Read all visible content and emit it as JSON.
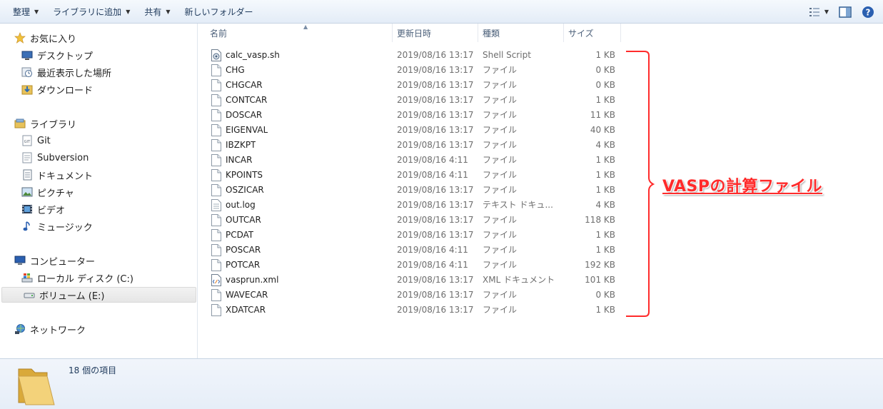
{
  "toolbar": {
    "organize": "整理",
    "add_to_library": "ライブラリに追加",
    "share": "共有",
    "new_folder": "新しいフォルダー"
  },
  "nav": {
    "favorites": "お気に入り",
    "desktop": "デスクトップ",
    "recent": "最近表示した場所",
    "downloads": "ダウンロード",
    "libraries": "ライブラリ",
    "git": "Git",
    "subversion": "Subversion",
    "documents": "ドキュメント",
    "pictures": "ピクチャ",
    "videos": "ビデオ",
    "music": "ミュージック",
    "computer": "コンピューター",
    "local_disk": "ローカル ディスク (C:)",
    "volume": "ボリューム (E:)",
    "network": "ネットワーク"
  },
  "columns": {
    "name": "名前",
    "date": "更新日時",
    "type": "種類",
    "size": "サイズ"
  },
  "files": [
    {
      "name": "calc_vasp.sh",
      "date": "2019/08/16 13:17",
      "type": "Shell Script",
      "size": "1 KB",
      "icon": "script-icon"
    },
    {
      "name": "CHG",
      "date": "2019/08/16 13:17",
      "type": "ファイル",
      "size": "0 KB",
      "icon": "file-icon"
    },
    {
      "name": "CHGCAR",
      "date": "2019/08/16 13:17",
      "type": "ファイル",
      "size": "0 KB",
      "icon": "file-icon"
    },
    {
      "name": "CONTCAR",
      "date": "2019/08/16 13:17",
      "type": "ファイル",
      "size": "1 KB",
      "icon": "file-icon"
    },
    {
      "name": "DOSCAR",
      "date": "2019/08/16 13:17",
      "type": "ファイル",
      "size": "11 KB",
      "icon": "file-icon"
    },
    {
      "name": "EIGENVAL",
      "date": "2019/08/16 13:17",
      "type": "ファイル",
      "size": "40 KB",
      "icon": "file-icon"
    },
    {
      "name": "IBZKPT",
      "date": "2019/08/16 13:17",
      "type": "ファイル",
      "size": "4 KB",
      "icon": "file-icon"
    },
    {
      "name": "INCAR",
      "date": "2019/08/16 4:11",
      "type": "ファイル",
      "size": "1 KB",
      "icon": "file-icon"
    },
    {
      "name": "KPOINTS",
      "date": "2019/08/16 4:11",
      "type": "ファイル",
      "size": "1 KB",
      "icon": "file-icon"
    },
    {
      "name": "OSZICAR",
      "date": "2019/08/16 13:17",
      "type": "ファイル",
      "size": "1 KB",
      "icon": "file-icon"
    },
    {
      "name": "out.log",
      "date": "2019/08/16 13:17",
      "type": "テキスト ドキュ...",
      "size": "4 KB",
      "icon": "text-file-icon"
    },
    {
      "name": "OUTCAR",
      "date": "2019/08/16 13:17",
      "type": "ファイル",
      "size": "118 KB",
      "icon": "file-icon"
    },
    {
      "name": "PCDAT",
      "date": "2019/08/16 13:17",
      "type": "ファイル",
      "size": "1 KB",
      "icon": "file-icon"
    },
    {
      "name": "POSCAR",
      "date": "2019/08/16 4:11",
      "type": "ファイル",
      "size": "1 KB",
      "icon": "file-icon"
    },
    {
      "name": "POTCAR",
      "date": "2019/08/16 4:11",
      "type": "ファイル",
      "size": "192 KB",
      "icon": "file-icon"
    },
    {
      "name": "vasprun.xml",
      "date": "2019/08/16 13:17",
      "type": "XML ドキュメント",
      "size": "101 KB",
      "icon": "xml-file-icon"
    },
    {
      "name": "WAVECAR",
      "date": "2019/08/16 13:17",
      "type": "ファイル",
      "size": "0 KB",
      "icon": "file-icon"
    },
    {
      "name": "XDATCAR",
      "date": "2019/08/16 13:17",
      "type": "ファイル",
      "size": "1 KB",
      "icon": "file-icon"
    }
  ],
  "annotation": {
    "label": "VASPの計算ファイル",
    "color": "#ff2b2b"
  },
  "status": {
    "item_count": "18 個の項目"
  },
  "colors": {
    "toolbar_text": "#1e395b",
    "header_text": "#4c607a",
    "secondary_text": "#6d6d6d",
    "folder": "#e8c25a"
  }
}
